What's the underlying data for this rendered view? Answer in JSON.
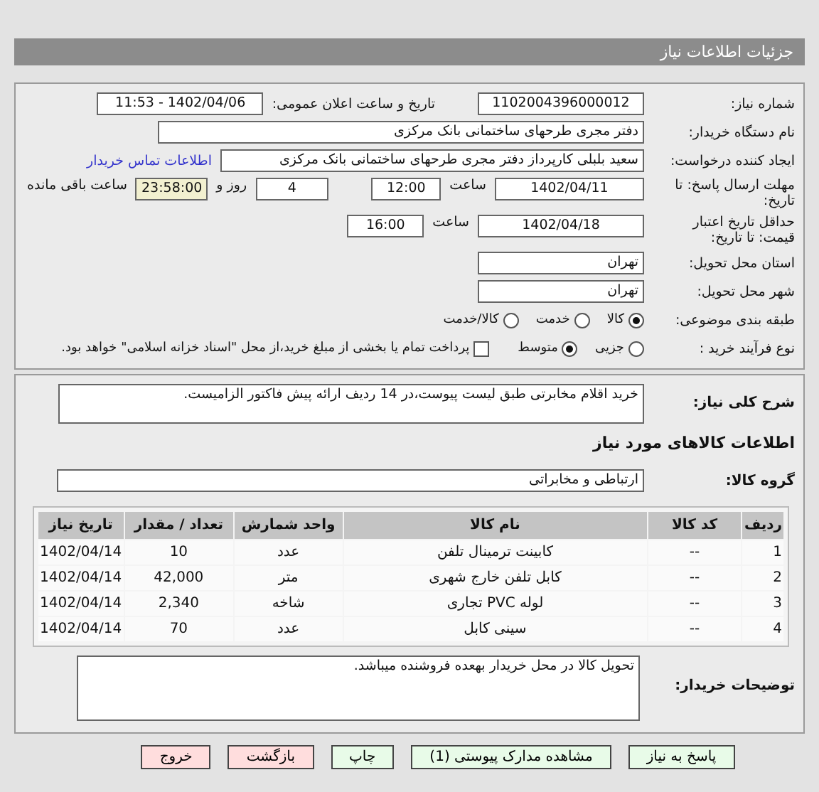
{
  "header": {
    "title": "جزئیات اطلاعات نیاز"
  },
  "need_number": {
    "label": "شماره نیاز:",
    "value": "1102004396000012"
  },
  "announce": {
    "label": "تاریخ و ساعت اعلان عمومی:",
    "value": "1402/04/06 - 11:53"
  },
  "buyer_org": {
    "label": "نام دستگاه خریدار:",
    "value": "دفتر مجری طرحهای ساختمانی بانک مرکزی"
  },
  "creator": {
    "label": "ایجاد کننده درخواست:",
    "value": "سعید بلبلی کارپرداز دفتر مجری طرحهای ساختمانی بانک مرکزی",
    "link": "اطلاعات تماس خریدار"
  },
  "deadline": {
    "label": "مهلت ارسال پاسخ: تا تاریخ:",
    "date": "1402/04/11",
    "time_label": "ساعت",
    "time": "12:00",
    "days": "4",
    "days_label": "روز و",
    "remaining": "23:58:00",
    "remaining_label": "ساعت باقی مانده"
  },
  "validity": {
    "label": "حداقل تاریخ اعتبار قیمت: تا تاریخ:",
    "date": "1402/04/18",
    "time_label": "ساعت",
    "time": "16:00"
  },
  "province": {
    "label": "استان محل تحویل:",
    "value": "تهران"
  },
  "city": {
    "label": "شهر محل تحویل:",
    "value": "تهران"
  },
  "category": {
    "label": "طبقه بندی موضوعی:",
    "options": [
      {
        "label": "کالا",
        "selected": true
      },
      {
        "label": "خدمت",
        "selected": false
      },
      {
        "label": "کالا/خدمت",
        "selected": false
      }
    ]
  },
  "process": {
    "label": "نوع فرآیند خرید :",
    "options": [
      {
        "label": "جزیی",
        "selected": false
      },
      {
        "label": "متوسط",
        "selected": true
      }
    ],
    "treasury": {
      "label": "پرداخت تمام یا بخشی از مبلغ خرید،از محل \"اسناد خزانه اسلامی\" خواهد بود.",
      "checked": false
    }
  },
  "description": {
    "label": "شرح کلی نیاز:",
    "value": "خرید اقلام مخابرتی طبق لیست پیوست،در 14 ردیف ارائه پیش فاکتور الزامیست."
  },
  "items_heading": "اطلاعات کالاهای مورد نیاز",
  "goods_group": {
    "label": "گروه کالا:",
    "value": "ارتباطی و مخابراتی"
  },
  "table": {
    "columns": [
      "ردیف",
      "کد کالا",
      "نام کالا",
      "واحد شمارش",
      "تعداد / مقدار",
      "تاریخ نیاز"
    ],
    "rows": [
      [
        "1",
        "--",
        "کابینت ترمینال تلفن",
        "عدد",
        "10",
        "1402/04/14"
      ],
      [
        "2",
        "--",
        "کابل تلفن خارج شهری",
        "متر",
        "42,000",
        "1402/04/14"
      ],
      [
        "3",
        "--",
        "لوله PVC تجاری",
        "شاخه",
        "2,340",
        "1402/04/14"
      ],
      [
        "4",
        "--",
        "سینی کابل",
        "عدد",
        "70",
        "1402/04/14"
      ]
    ]
  },
  "buyer_notes": {
    "label": "توضیحات خریدار:",
    "value": "تحویل کالا در محل خریدار بهعده فروشنده میباشد."
  },
  "buttons": [
    {
      "label": "پاسخ به نیاز",
      "kind": "primary"
    },
    {
      "label": "مشاهده مدارک پیوستی (1)",
      "kind": "primary"
    },
    {
      "label": "چاپ",
      "kind": "primary"
    },
    {
      "label": "بازگشت",
      "kind": "danger"
    },
    {
      "label": "خروج",
      "kind": "danger"
    }
  ]
}
